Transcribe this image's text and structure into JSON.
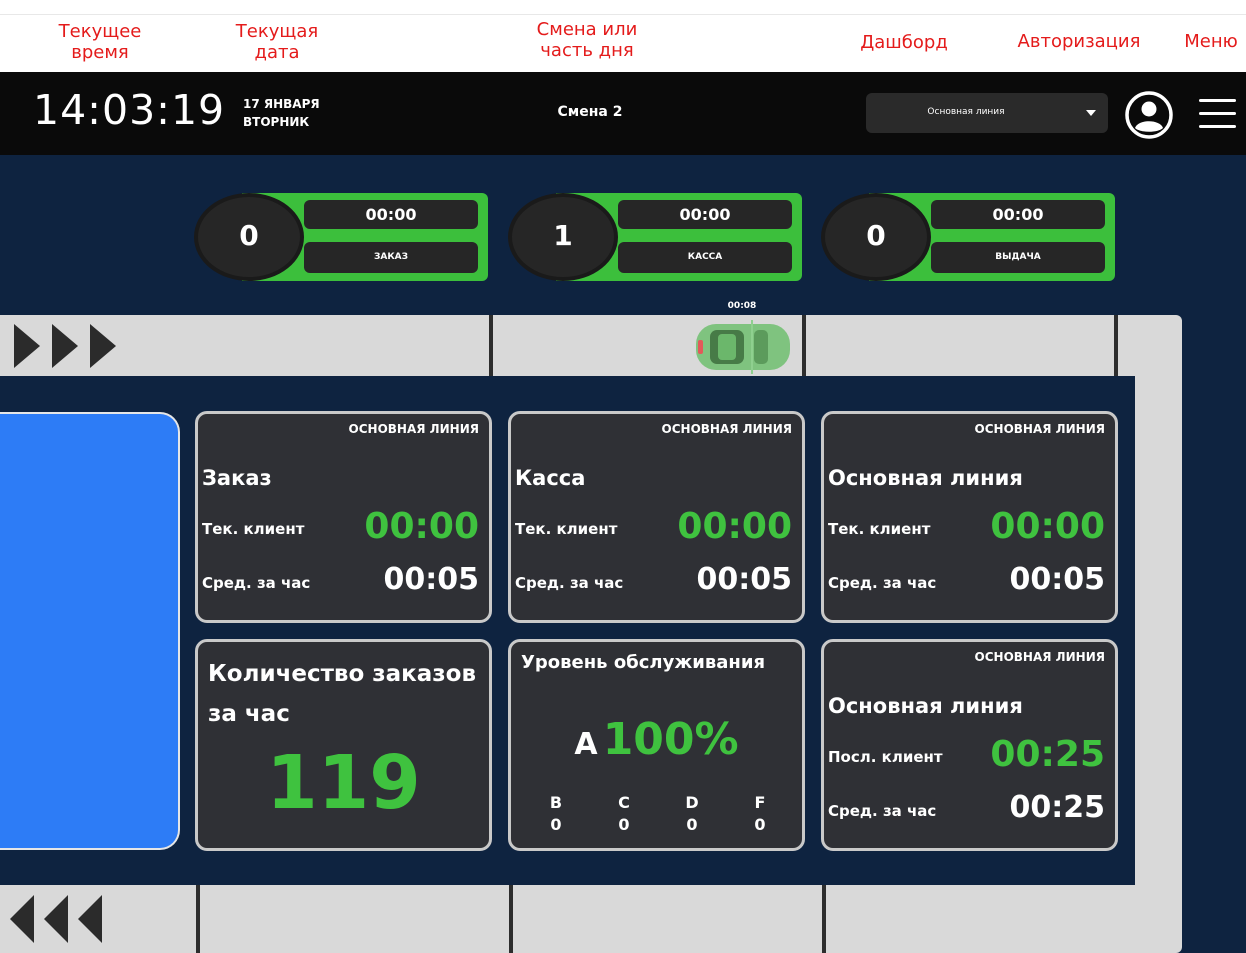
{
  "annotations": {
    "current_time": [
      "Текущее",
      "время"
    ],
    "current_date": [
      "Текущая",
      "дата"
    ],
    "shift_or_daypart": [
      "Смена или",
      "часть дня"
    ],
    "dashboard": "Дашборд",
    "authorization": "Авторизация",
    "menu": "Меню"
  },
  "topbar": {
    "time": "14:03:19",
    "date_day": "17 ЯНВАРЯ",
    "date_weekday": "ВТОРНИК",
    "shift": "Смена 2",
    "line_select": {
      "selected": "Основная линия"
    },
    "icons": {
      "account": "user-circle-icon",
      "menu": "hamburger-menu-icon"
    }
  },
  "stations": [
    {
      "count": "0",
      "time": "00:00",
      "label": "ЗАКАЗ"
    },
    {
      "count": "1",
      "time": "00:00",
      "label": "КАССА"
    },
    {
      "count": "0",
      "time": "00:00",
      "label": "ВЫДАЧА"
    }
  ],
  "track": {
    "car_time": "00:08",
    "icons": {
      "forward": "triple-chevron-right-icon",
      "back": "triple-chevron-left-icon",
      "car": "car-topview-icon"
    }
  },
  "cards": {
    "order": {
      "tag": "ОСНОВНАЯ ЛИНИЯ",
      "title": "Заказ",
      "current_label": "Тек. клиент",
      "current_value": "00:00",
      "avg_label": "Сред. за час",
      "avg_value": "00:05"
    },
    "cashier": {
      "tag": "ОСНОВНАЯ ЛИНИЯ",
      "title": "Касса",
      "current_label": "Тек. клиент",
      "current_value": "00:00",
      "avg_label": "Сред. за час",
      "avg_value": "00:05"
    },
    "mainline": {
      "tag": "ОСНОВНАЯ ЛИНИЯ",
      "title": "Основная линия",
      "current_label": "Тек. клиент",
      "current_value": "00:00",
      "avg_label": "Сред. за час",
      "avg_value": "00:05"
    },
    "orders_per_hour": {
      "title_line1": "Количество заказов",
      "title_line2": "за час",
      "value": "119"
    },
    "service_level": {
      "title": "Уровень обслуживания",
      "grade": "A",
      "percent": "100%",
      "grades": [
        {
          "letter": "B",
          "count": "0"
        },
        {
          "letter": "C",
          "count": "0"
        },
        {
          "letter": "D",
          "count": "0"
        },
        {
          "letter": "F",
          "count": "0"
        }
      ]
    },
    "last_client": {
      "tag": "ОСНОВНАЯ ЛИНИЯ",
      "title": "Основная линия",
      "last_label": "Посл. клиент",
      "last_value": "00:25",
      "avg_label": "Сред. за час",
      "avg_value": "00:25"
    }
  },
  "colors": {
    "accent_green": "#3fc23f",
    "panel_blue": "#2d7cf6",
    "background_navy": "#0e2340",
    "annotation_red": "#e41b1b"
  }
}
